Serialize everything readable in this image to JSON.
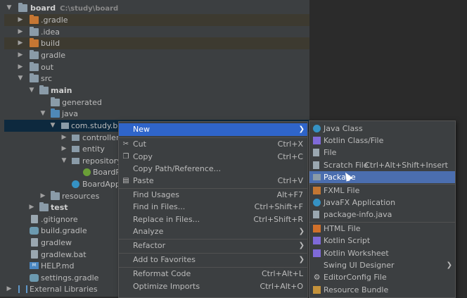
{
  "tree": {
    "root": {
      "label": "board",
      "path": "C:\\study\\board"
    },
    "items": [
      {
        "label": ".gradle"
      },
      {
        "label": ".idea"
      },
      {
        "label": "build"
      },
      {
        "label": "gradle"
      },
      {
        "label": "out"
      },
      {
        "label": "src"
      },
      {
        "label": "main"
      },
      {
        "label": "generated"
      },
      {
        "label": "java"
      },
      {
        "label": "com.study.boar"
      },
      {
        "label": "controller"
      },
      {
        "label": "entity"
      },
      {
        "label": "repository"
      },
      {
        "label": "BoardRe"
      },
      {
        "label": "BoardAppli"
      },
      {
        "label": "resources"
      },
      {
        "label": "test"
      },
      {
        "label": ".gitignore"
      },
      {
        "label": "build.gradle"
      },
      {
        "label": "gradlew"
      },
      {
        "label": "gradlew.bat"
      },
      {
        "label": "HELP.md"
      },
      {
        "label": "settings.gradle"
      },
      {
        "label": "External Libraries"
      }
    ]
  },
  "context_menu": {
    "items": [
      {
        "label": "New",
        "arrow": "❯"
      },
      {
        "label": "Cut",
        "shortcut": "Ctrl+X"
      },
      {
        "label": "Copy",
        "shortcut": "Ctrl+C"
      },
      {
        "label": "Copy Path/Reference..."
      },
      {
        "label": "Paste",
        "shortcut": "Ctrl+V"
      },
      {
        "label": "Find Usages",
        "shortcut": "Alt+F7"
      },
      {
        "label": "Find in Files...",
        "shortcut": "Ctrl+Shift+F"
      },
      {
        "label": "Replace in Files...",
        "shortcut": "Ctrl+Shift+R"
      },
      {
        "label": "Analyze",
        "arrow": "❯"
      },
      {
        "label": "Refactor",
        "arrow": "❯"
      },
      {
        "label": "Add to Favorites",
        "arrow": "❯"
      },
      {
        "label": "Reformat Code",
        "shortcut": "Ctrl+Alt+L"
      },
      {
        "label": "Optimize Imports",
        "shortcut": "Ctrl+Alt+O"
      }
    ]
  },
  "submenu": {
    "items": [
      {
        "label": "Java Class"
      },
      {
        "label": "Kotlin Class/File"
      },
      {
        "label": "File"
      },
      {
        "label": "Scratch File",
        "shortcut": "Ctrl+Alt+Shift+Insert"
      },
      {
        "label": "Package"
      },
      {
        "label": "FXML File"
      },
      {
        "label": "JavaFX Application"
      },
      {
        "label": "package-info.java"
      },
      {
        "label": "HTML File"
      },
      {
        "label": "Kotlin Script"
      },
      {
        "label": "Kotlin Worksheet"
      },
      {
        "label": "Swing UI Designer",
        "arrow": "❯"
      },
      {
        "label": "EditorConfig File"
      },
      {
        "label": "Resource Bundle"
      }
    ]
  },
  "colors": {
    "highlight": "#2f65ca",
    "selection": "#0d293e",
    "excluded": "#3d3a30",
    "submenu_highlight": "#4b6eaf"
  }
}
